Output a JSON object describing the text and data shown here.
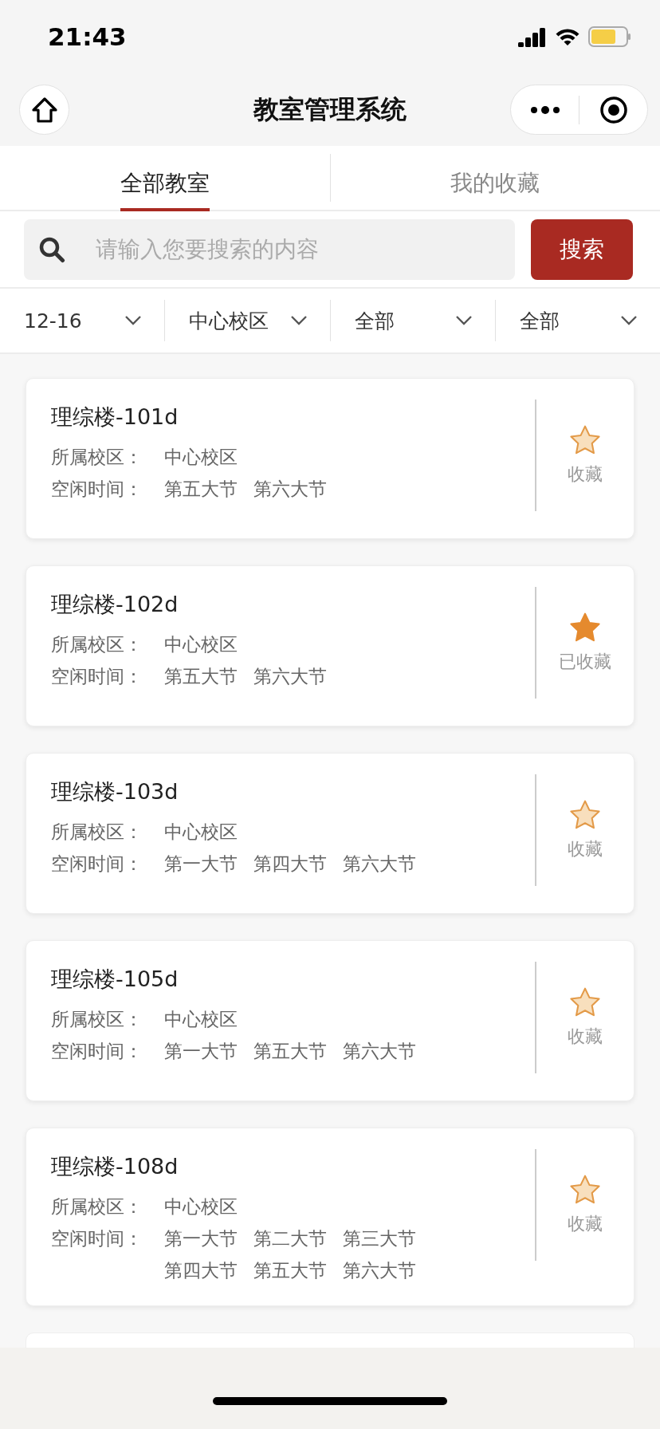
{
  "status_bar": {
    "time": "21:43"
  },
  "nav_bar": {
    "title": "教室管理系统"
  },
  "tabs": [
    {
      "label": "全部教室",
      "selected": true
    },
    {
      "label": "我的收藏",
      "selected": false
    }
  ],
  "search": {
    "placeholder": "请输入您要搜索的内容",
    "button": "搜索"
  },
  "filters": [
    {
      "label": "12-16"
    },
    {
      "label": "中心校区"
    },
    {
      "label": "全部"
    },
    {
      "label": "全部"
    }
  ],
  "rooms": [
    {
      "name": "理综楼-101d",
      "campus_label": "所属校区：",
      "campus": "中心校区",
      "free_label": "空闲时间：",
      "periods": [
        "第五大节",
        "第六大节"
      ],
      "favorited": false,
      "favorite_label": "收藏"
    },
    {
      "name": "理综楼-102d",
      "campus_label": "所属校区：",
      "campus": "中心校区",
      "free_label": "空闲时间：",
      "periods": [
        "第五大节",
        "第六大节"
      ],
      "favorited": true,
      "favorite_label": "已收藏"
    },
    {
      "name": "理综楼-103d",
      "campus_label": "所属校区：",
      "campus": "中心校区",
      "free_label": "空闲时间：",
      "periods": [
        "第一大节",
        "第四大节",
        "第六大节"
      ],
      "favorited": false,
      "favorite_label": "收藏"
    },
    {
      "name": "理综楼-105d",
      "campus_label": "所属校区：",
      "campus": "中心校区",
      "free_label": "空闲时间：",
      "periods": [
        "第一大节",
        "第五大节",
        "第六大节"
      ],
      "favorited": false,
      "favorite_label": "收藏"
    },
    {
      "name": "理综楼-108d",
      "campus_label": "所属校区：",
      "campus": "中心校区",
      "free_label": "空闲时间：",
      "periods": [
        "第一大节",
        "第二大节",
        "第三大节",
        "第四大节",
        "第五大节",
        "第六大节"
      ],
      "favorited": false,
      "favorite_label": "收藏"
    }
  ]
}
